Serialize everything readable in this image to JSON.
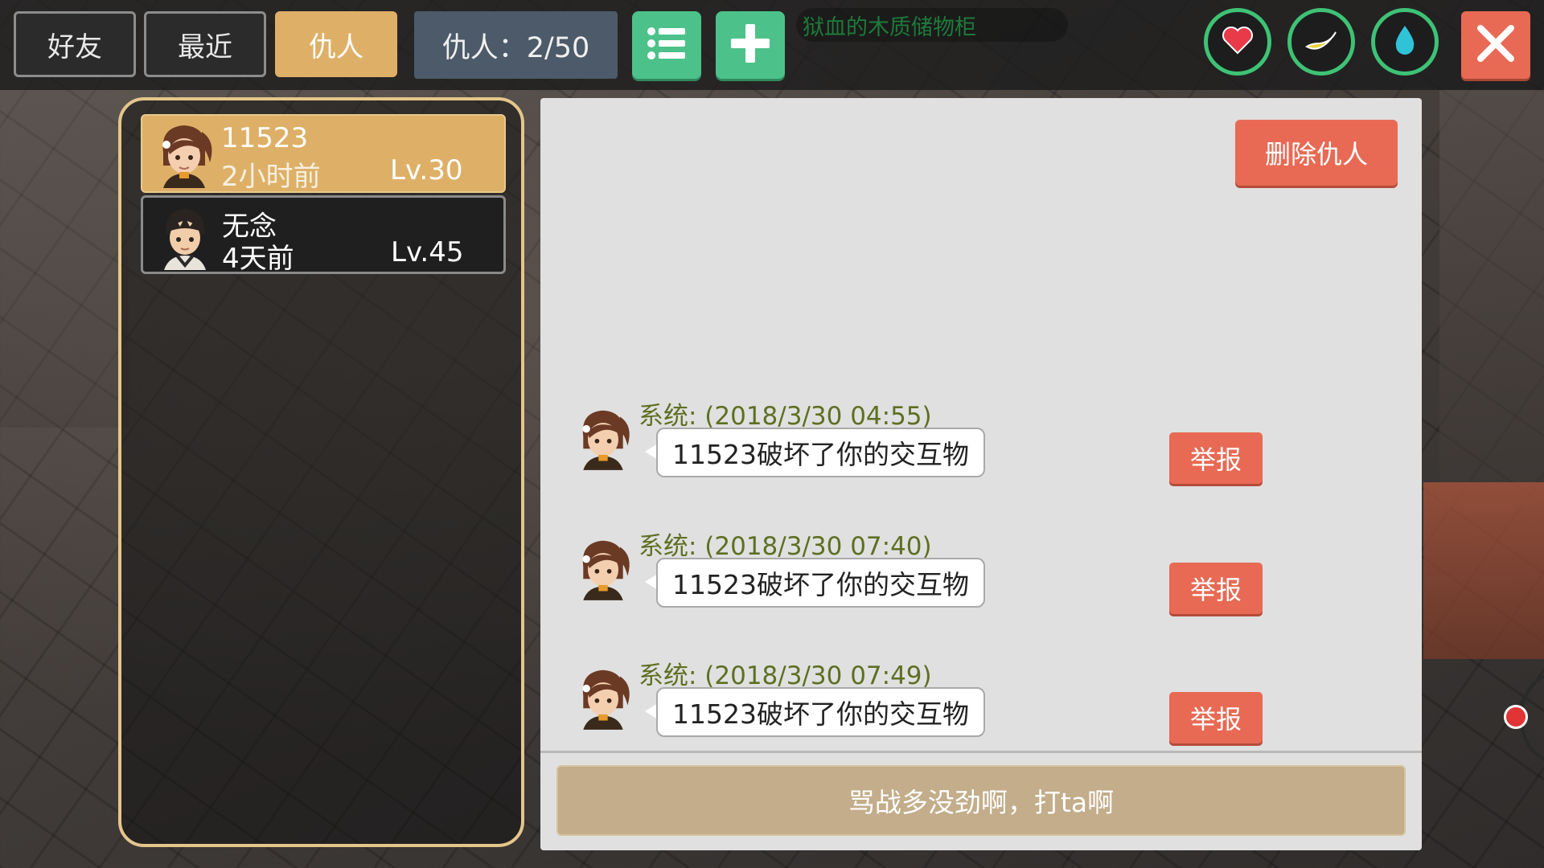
{
  "tabs": {
    "friends": "好友",
    "recent": "最近",
    "enemies": "仇人"
  },
  "enemy_counter": "仇人：2/50",
  "location_label": "狱血的木质储物柜",
  "icons": {
    "list": "list-icon",
    "add": "plus-icon",
    "health": "heart-icon",
    "hunger": "banana-icon",
    "thirst": "water-drop-icon",
    "close": "close-icon"
  },
  "colors": {
    "accent_gold": "#deb067",
    "green": "#4cc28a",
    "red": "#e86a54",
    "timestamp_olive": "#5e6f22"
  },
  "enemies": [
    {
      "name": "11523",
      "last_seen": "2小时前",
      "level": "Lv.30",
      "selected": true
    },
    {
      "name": "无念",
      "last_seen": "4天前",
      "level": "Lv.45",
      "selected": false
    }
  ],
  "delete_enemy_label": "删除仇人",
  "messages": [
    {
      "header": "系统:  (2018/3/30 04:55)",
      "text": "11523破坏了你的交互物",
      "report": "举报"
    },
    {
      "header": "系统:  (2018/3/30 07:40)",
      "text": "11523破坏了你的交互物",
      "report": "举报"
    },
    {
      "header": "系统:  (2018/3/30 07:49)",
      "text": "11523破坏了你的交互物",
      "report": "举报"
    }
  ],
  "fight_button_label": "骂战多没劲啊，打ta啊"
}
